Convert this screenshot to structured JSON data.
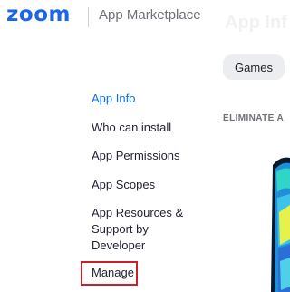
{
  "header": {
    "logo_text": "zoom",
    "marketplace_label": "App Marketplace",
    "background_title": "App Inf"
  },
  "chip": {
    "label": "Games"
  },
  "nav": {
    "items": [
      {
        "label": "App Info",
        "active": true
      },
      {
        "label": "Who can install",
        "active": false
      },
      {
        "label": "App Permissions",
        "active": false
      },
      {
        "label": "App Scopes",
        "active": false
      },
      {
        "label": "App Resources & Support by Developer",
        "active": false
      },
      {
        "label": "Manage",
        "active": false
      }
    ]
  },
  "banner": {
    "label": "ELIMINATE A"
  },
  "colors": {
    "brand_blue": "#1a66e6",
    "active_link": "#0e71eb",
    "highlight_red": "#cc1f2b",
    "chip_bg": "#ebedf0"
  }
}
